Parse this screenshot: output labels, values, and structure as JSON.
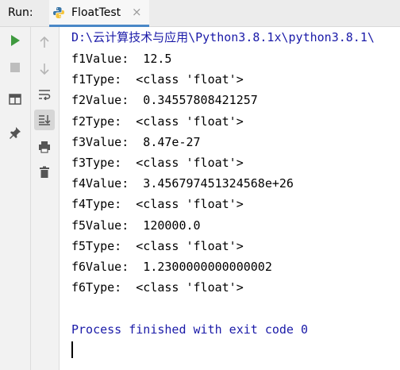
{
  "run_bar": {
    "label": "Run:",
    "tab_label": "FloatTest",
    "close_glyph": "×",
    "tab_icon": "python-icon"
  },
  "console": {
    "path_line": "D:\\云计算技术与应用\\Python3.8.1x\\python3.8.1\\",
    "output_lines": [
      "f1Value:  12.5",
      "f1Type:  <class 'float'>",
      "f2Value:  0.34557808421257",
      "f2Type:  <class 'float'>",
      "f3Value:  8.47e-27",
      "f3Type:  <class 'float'>",
      "f4Value:  3.456797451324568e+26",
      "f4Type:  <class 'float'>",
      "f5Value:  120000.0",
      "f5Type:  <class 'float'>",
      "f6Value:  1.2300000000000002",
      "f6Type:  <class 'float'>"
    ],
    "exit_line": "Process finished with exit code 0"
  },
  "toolbar_left": [
    "rerun-icon",
    "stop-icon",
    "layout-icon",
    "pin-icon"
  ],
  "toolbar_right": [
    "up-arrow-icon",
    "down-arrow-icon",
    "soft-wrap-icon",
    "scroll-to-end-icon",
    "print-icon",
    "trash-icon"
  ],
  "colors": {
    "accent": "#4a88c7",
    "run_green": "#3f9a3f",
    "path_blue": "#1a1aa8"
  }
}
